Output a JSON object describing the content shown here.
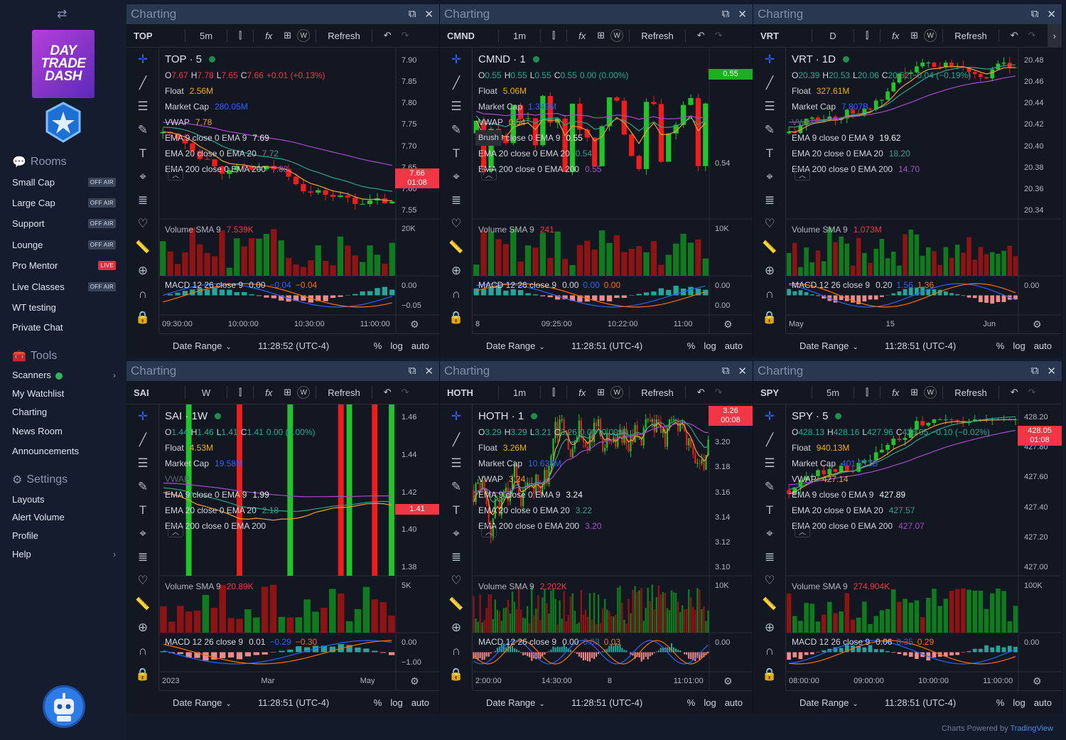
{
  "sidebar": {
    "sections": {
      "rooms": "Rooms",
      "tools": "Tools",
      "settings": "Settings"
    },
    "rooms": [
      {
        "label": "Small Cap",
        "badge": "OFF AIR"
      },
      {
        "label": "Large Cap",
        "badge": "OFF AIR"
      },
      {
        "label": "Support",
        "badge": "OFF AIR"
      },
      {
        "label": "Lounge",
        "badge": "OFF AIR"
      },
      {
        "label": "Pro Mentor",
        "badge": "LIVE"
      },
      {
        "label": "Live Classes",
        "badge": "OFF AIR"
      },
      {
        "label": "WT testing",
        "badge": ""
      },
      {
        "label": "Private Chat",
        "badge": ""
      }
    ],
    "tools": [
      "Scanners",
      "My Watchlist",
      "Charting",
      "News Room",
      "Announcements"
    ],
    "settings": [
      "Layouts",
      "Alert Volume",
      "Profile",
      "Help"
    ],
    "logo": {
      "line1": "DAY",
      "line2": "TRADE",
      "line3": "DASH"
    }
  },
  "common": {
    "panel_title": "Charting",
    "refresh": "Refresh",
    "date_range": "Date Range",
    "pct": "%",
    "log": "log",
    "auto": "auto",
    "fx": "fx"
  },
  "footer": {
    "prefix": "Charts Powered by ",
    "brand": "TradingView"
  },
  "panels": [
    {
      "symbol": "TOP",
      "interval": "5m",
      "title": "TOP · 5",
      "ohlc": {
        "o": "7.67",
        "h": "7.78",
        "l": "7.65",
        "c": "7.66",
        "chg": "+0.01 (+0.13%)"
      },
      "float": "2.56M",
      "mcap": "280.05M",
      "vwap": "7.78",
      "ema9": "7.69",
      "ema20": "7.72",
      "ema200": "7.88",
      "vol": "7.539K",
      "macd": [
        "0.00",
        "−0.04",
        "−0.04"
      ],
      "yticks": [
        "7.90",
        "7.85",
        "7.80",
        "7.75",
        "7.70",
        "7.65",
        "7.60",
        "7.55"
      ],
      "vticks": [
        "20K"
      ],
      "mticks": [
        "0.00",
        "−0.05"
      ],
      "xticks": [
        "09:30:00",
        "10:00:00",
        "10:30:00",
        "11:00:00"
      ],
      "price": "7.66",
      "countdown": "01:08",
      "time": "11:28:52 (UTC-4)",
      "trend": "down"
    },
    {
      "symbol": "CMND",
      "interval": "1m",
      "title": "CMND · 1",
      "ohlc": {
        "o": "0.55",
        "h": "0.55",
        "l": "0.55",
        "c": "0.55",
        "chg": "0.00 (0.00%)"
      },
      "float": "5.06M",
      "mcap": "1.349M",
      "vwap": "0.54",
      "ema9": "0.55",
      "ema20": "0.54",
      "ema200": "0.55",
      "vol": "241",
      "macd": [
        "0.00",
        "0.00",
        "0.00"
      ],
      "yticks": [
        "0.54"
      ],
      "vticks": [
        "10K"
      ],
      "mticks": [
        "0.00",
        "0.00"
      ],
      "xticks": [
        "8",
        "09:25:00",
        "10:22:00",
        "11:00"
      ],
      "price": "0.55",
      "countdown": "",
      "time": "11:28:51 (UTC-4)",
      "trend": "flat",
      "brush": "Brush"
    },
    {
      "symbol": "VRT",
      "interval": "D",
      "title": "VRT · 1D",
      "ohlc": {
        "o": "20.39",
        "h": "20.53",
        "l": "20.06",
        "c": "20.52",
        "chg": "−0.04 (−0.19%)"
      },
      "float": "327.61M",
      "mcap": "7.807B",
      "vwap": "",
      "ema9": "19.62",
      "ema20": "18.20",
      "ema200": "14.70",
      "vol": "1.073M",
      "macd": [
        "0.20",
        "1.56",
        "1.36"
      ],
      "yticks": [
        "20.48",
        "20.46",
        "20.44",
        "20.42",
        "20.40",
        "20.38",
        "20.36",
        "20.34"
      ],
      "vticks": [],
      "mticks": [
        "0.00"
      ],
      "xticks": [
        "May",
        "15",
        "Jun"
      ],
      "price": "",
      "countdown": "",
      "time": "11:28:51 (UTC-4)",
      "trend": "up"
    },
    {
      "symbol": "SAI",
      "interval": "W",
      "title": "SAI · 1W",
      "ohlc": {
        "o": "1.44",
        "h": "1.46",
        "l": "1.41",
        "c": "1.41",
        "chg": "0.00 (0.00%)"
      },
      "float": "4.53M",
      "mcap": "19.58M",
      "vwap": "",
      "ema9": "1.99",
      "ema20": "2.18",
      "ema200": "",
      "vol": "20.89K",
      "macd": [
        "0.01",
        "−0.29",
        "−0.30"
      ],
      "yticks": [
        "1.46",
        "1.44",
        "1.42",
        "1.40",
        "1.38"
      ],
      "vticks": [
        "5K"
      ],
      "mticks": [
        "0.00",
        "−1.00"
      ],
      "xticks": [
        "2023",
        "Mar",
        "May"
      ],
      "price": "1.41",
      "countdown": "",
      "time": "11:28:51 (UTC-4)",
      "trend": "bars"
    },
    {
      "symbol": "HOTH",
      "interval": "1m",
      "title": "HOTH · 1",
      "ohlc": {
        "o": "3.29",
        "h": "3.29",
        "l": "3.21",
        "c": "3.26",
        "chg": "0.00 (0.00%)"
      },
      "float": "3.26M",
      "mcap": "10.633M",
      "vwap": "3.24",
      "ema9": "3.24",
      "ema20": "3.22",
      "ema200": "3.20",
      "vol": "2.202K",
      "macd": [
        "0.00",
        "0.03",
        "0.03"
      ],
      "yticks": [
        "3.22",
        "3.20",
        "3.18",
        "3.16",
        "3.14",
        "3.12",
        "3.10"
      ],
      "vticks": [
        "10K"
      ],
      "mticks": [
        "0.00"
      ],
      "xticks": [
        "2:00:00",
        "14:30:00",
        "8",
        "11:01:00"
      ],
      "price": "3.26",
      "countdown": "00:08",
      "time": "11:28:51 (UTC-4)",
      "trend": "noisy"
    },
    {
      "symbol": "SPY",
      "interval": "5m",
      "title": "SPY · 5",
      "ohlc": {
        "o": "428.13",
        "h": "428.16",
        "l": "427.96",
        "c": "428.05",
        "chg": "−0.10 (−0.02%)"
      },
      "float": "940.13M",
      "mcap": "401.012B",
      "vwap": "427.14",
      "ema9": "427.89",
      "ema20": "427.57",
      "ema200": "427.07",
      "vol": "274.904K",
      "macd": [
        "0.06",
        "0.35",
        "0.29"
      ],
      "yticks": [
        "428.20",
        "427.80",
        "427.60",
        "427.40",
        "427.20",
        "427.00"
      ],
      "vticks": [
        "100K"
      ],
      "mticks": [
        "0.00"
      ],
      "xticks": [
        "08:00:00",
        "09:00:00",
        "10:00:00",
        "11:00:00"
      ],
      "price": "428.05",
      "countdown": "01:08",
      "time": "11:28:51 (UTC-4)",
      "trend": "up"
    }
  ],
  "labels": {
    "float": "Float",
    "mcap": "Market Cap",
    "vwap": "VWAP",
    "ema9": "EMA 9 close 0 EMA 9",
    "ema20": "EMA 20 close 0 EMA 20",
    "ema200": "EMA 200 close 0 EMA 200",
    "vol": "Volume SMA 9",
    "macd": "MACD 12 26 close 9"
  },
  "colors": {
    "up": "#22c32b",
    "down": "#f01d1d",
    "ema9": "#f0a030",
    "ema20": "#34a08a",
    "ema200": "#a64cc8",
    "accent": "#2962ff"
  }
}
